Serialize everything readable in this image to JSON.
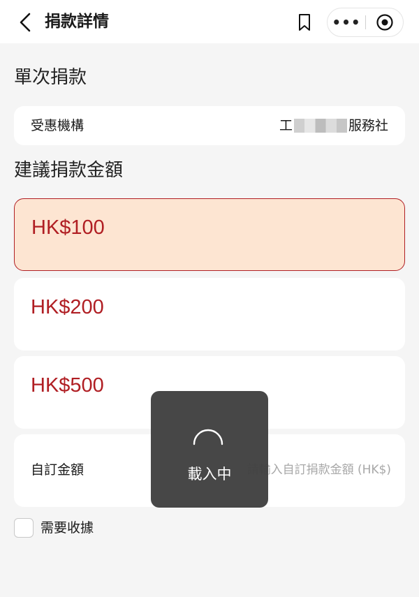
{
  "header": {
    "title": "捐款詳情",
    "back_icon": "chevron-left-icon",
    "bookmark_icon": "bookmark-icon",
    "more_label": "•••",
    "close_icon": "target-icon"
  },
  "sections": {
    "single_donation": "單次捐款",
    "suggested_amount": "建議捐款金額"
  },
  "org": {
    "label": "受惠機構",
    "value_prefix": "工",
    "value_suffix": "服務社"
  },
  "amounts": {
    "options": [
      "HK$100",
      "HK$200",
      "HK$500"
    ],
    "selected_index": 0
  },
  "custom": {
    "label": "自訂金額",
    "placeholder": "請輸入自訂捐款金額 (HK$)"
  },
  "receipt": {
    "label": "需要收據",
    "checked": false
  },
  "toast": {
    "text": "載入中"
  },
  "colors": {
    "accent": "#b01e23",
    "selected_bg": "#fde5d2",
    "page_bg": "#f5f5f5",
    "toast_bg": "#404040"
  }
}
